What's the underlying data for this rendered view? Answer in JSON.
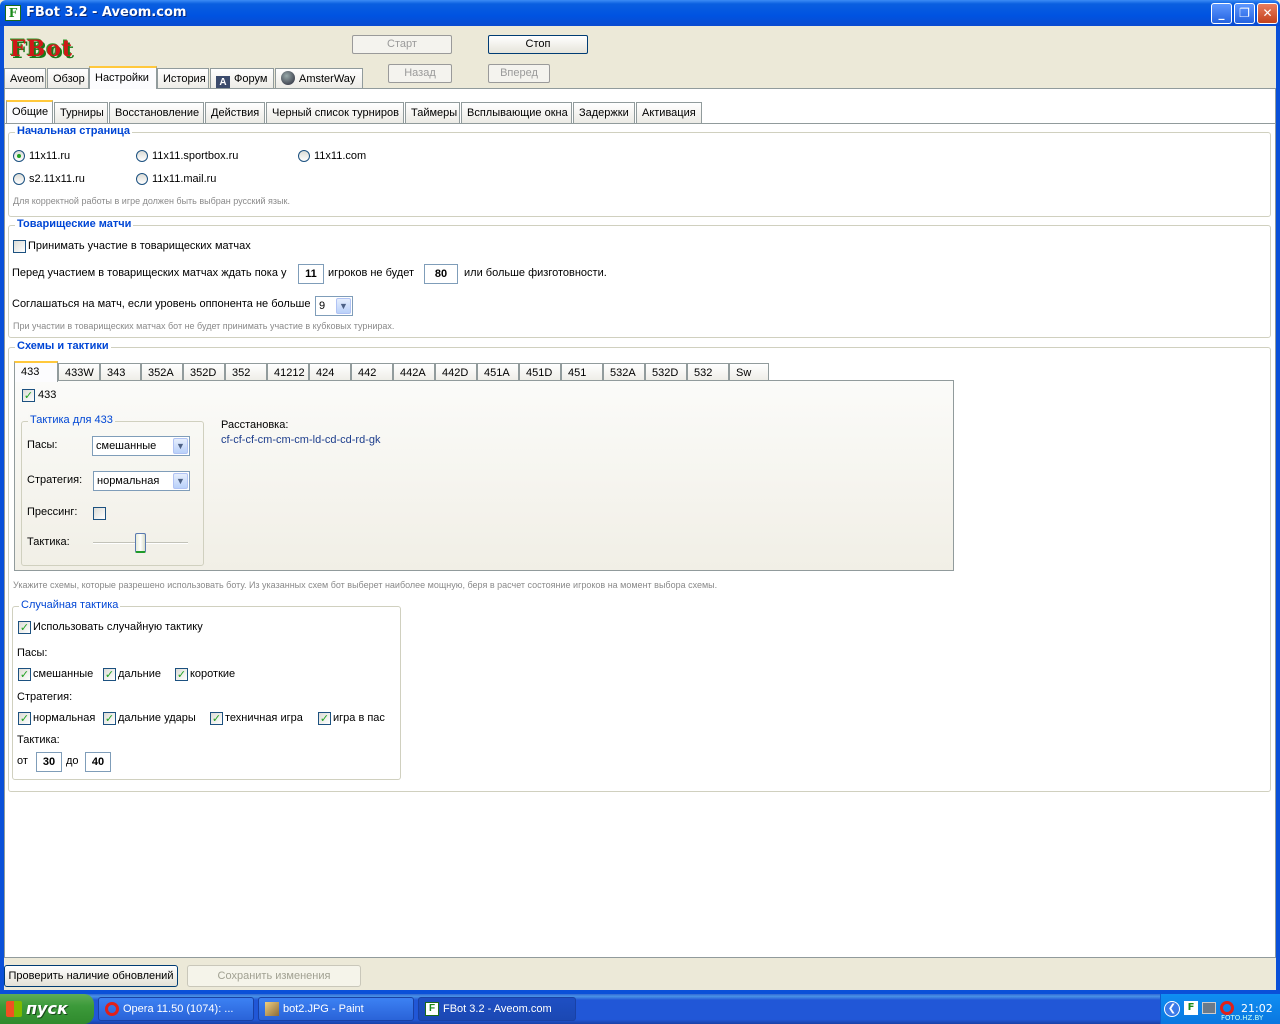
{
  "window": {
    "title": "FBot 3.2 - Aveom.com",
    "icon_letter": "F"
  },
  "logo": "FBot",
  "toolbar": {
    "start": "Старт",
    "stop": "Стоп",
    "back": "Назад",
    "forward": "Вперед"
  },
  "main_tabs": [
    "Aveom",
    "Обзор",
    "Настройки",
    "История",
    "Форум",
    "AmsterWay"
  ],
  "sub_tabs": [
    "Общие",
    "Турниры",
    "Восстановление",
    "Действия",
    "Черный список турниров",
    "Таймеры",
    "Всплывающие окна",
    "Задержки",
    "Активация"
  ],
  "start_page": {
    "title": "Начальная страница",
    "options": [
      "11x11.ru",
      "11x11.sportbox.ru",
      "11x11.com",
      "s2.11x11.ru",
      "11x11.mail.ru"
    ],
    "selected": "11x11.ru",
    "hint": "Для корректной работы в игре должен быть выбран русский язык."
  },
  "friendly": {
    "title": "Товарищеские матчи",
    "participate_label": "Принимать участие в товарищеских матчах",
    "wait_before": "Перед участием в товарищеских матчах ждать пока у",
    "wait_players": "11",
    "wait_middle": "игроков не будет",
    "wait_fitness": "80",
    "wait_after": "или больше физготовности.",
    "level_label": "Соглашаться на матч, если уровень оппонента не больше",
    "level_value": "9",
    "hint": "При участии в товарищеских матчах бот не будет принимать участие в кубковых турнирах."
  },
  "schemes": {
    "title": "Схемы и тактики",
    "tabs": [
      "433",
      "433W",
      "343",
      "352A",
      "352D",
      "352",
      "41212",
      "424",
      "442",
      "442A",
      "442D",
      "451A",
      "451D",
      "451",
      "532A",
      "532D",
      "532",
      "Sw"
    ],
    "enabled_label": "433",
    "tactic_title": "Тактика для 433",
    "passes_label": "Пасы:",
    "passes_value": "смешанные",
    "strategy_label": "Стратегия:",
    "strategy_value": "нормальная",
    "pressing_label": "Прессинг:",
    "tactic_label": "Тактика:",
    "tactic_level": 0.5,
    "arrangement_label": "Расстановка:",
    "arrangement_value": "cf-cf-cf-cm-cm-cm-ld-cd-cd-rd-gk",
    "hint": "Укажите схемы, которые разрешено использовать боту. Из указанных схем бот выберет наиболее мощную, беря в расчет состояние игроков на момент выбора схемы."
  },
  "random": {
    "title": "Случайная тактика",
    "use_label": "Использовать случайную тактику",
    "passes_label": "Пасы:",
    "passes": [
      "смешанные",
      "дальние",
      "короткие"
    ],
    "strategy_label": "Стратегия:",
    "strategies": [
      "нормальная",
      "дальние удары",
      "техничная игра",
      "игра в пас"
    ],
    "tactic_label": "Тактика:",
    "from_label": "от",
    "from_value": "30",
    "to_label": "до",
    "to_value": "40"
  },
  "bottom": {
    "check_updates": "Проверить наличие обновлений",
    "save": "Сохранить изменения"
  },
  "taskbar": {
    "start": "пуск",
    "tasks": [
      "Opera 11.50 (1074): ...",
      "bot2.JPG - Paint",
      "FBot 3.2 - Aveom.com"
    ],
    "clock": "21:02",
    "watermark": "FOTO.HZ.BY"
  },
  "colors": {
    "accent": "#0046d5",
    "check": "#21a121",
    "titlebar": "#0053e1"
  }
}
